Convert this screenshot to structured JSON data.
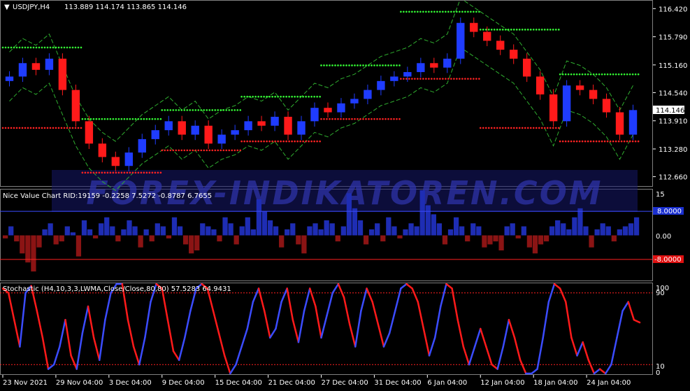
{
  "chart": {
    "symbol": "USDJPY,H4",
    "ohlc": "113.889 114.174 113.865 114.146",
    "current_price": "114.146",
    "watermark": "FOREX-INDIKATOREN.COM"
  },
  "colors": {
    "background": "#000000",
    "bull_candle": "#1f3cff",
    "bear_candle": "#ff1a1a",
    "envelope": "#2fae2f",
    "resistance_dots": "#35ff35",
    "support_dots": "#ff2222",
    "watermark": "#2b2f9c",
    "nvc_positive": "#1e2db4",
    "nvc_negative": "#8b1414",
    "stoch_up": "#3b4cff",
    "stoch_down": "#ff1a1a",
    "level_lines": "#ff2020"
  },
  "price_axis": [
    "116.420",
    "115.790",
    "115.160",
    "114.540",
    "113.910",
    "113.280",
    "112.660"
  ],
  "time_axis": [
    "23 Nov 2021",
    "29 Nov 04:00",
    "3 Dec 04:00",
    "9 Dec 04:00",
    "15 Dec 04:00",
    "21 Dec 04:00",
    "27 Dec 04:00",
    "31 Dec 04:00",
    "6 Jan 04:00",
    "12 Jan 04:00",
    "18 Jan 04:00",
    "24 Jan 04:00"
  ],
  "nvc": {
    "title": "Nice Value Chart RID:19159 -0.2258 7.5272 -0.8787 6.7655",
    "axis_top": "15",
    "axis_mid": "0.00",
    "level_upper": "8.0000",
    "level_lower": "-8.0000"
  },
  "stoch": {
    "title": "Stochastic (H4,10,3,3,LWMA,Close/Close,80,80) 57.5283 64.9431",
    "axis_100": "100",
    "axis_90": "90",
    "axis_10": "10",
    "axis_0": "0"
  },
  "chart_data": [
    {
      "type": "line",
      "title": "USDJPY,H4",
      "x": [
        0,
        4,
        8,
        12,
        16,
        20,
        24,
        28,
        32,
        36,
        40,
        44,
        48,
        52,
        56,
        60,
        64,
        68,
        72,
        76,
        80,
        84,
        88,
        92,
        96,
        100,
        104,
        108,
        112,
        116,
        120,
        124,
        128,
        132,
        136,
        140,
        144,
        148,
        152,
        156,
        160,
        164,
        168,
        172,
        176,
        180,
        184,
        188
      ],
      "x_tick_labels": [
        "23 Nov 2021",
        "29 Nov 04:00",
        "3 Dec 04:00",
        "9 Dec 04:00",
        "15 Dec 04:00",
        "21 Dec 04:00",
        "27 Dec 04:00",
        "31 Dec 04:00",
        "6 Jan 04:00",
        "12 Jan 04:00",
        "18 Jan 04:00",
        "24 Jan 04:00"
      ],
      "series": [
        {
          "name": "USDJPY",
          "values": [
            114.9,
            115.2,
            115.05,
            115.3,
            114.6,
            113.9,
            113.4,
            113.1,
            112.9,
            113.2,
            113.5,
            113.7,
            113.9,
            113.6,
            113.8,
            113.4,
            113.6,
            113.7,
            113.9,
            113.8,
            114.0,
            113.6,
            113.9,
            114.2,
            114.1,
            114.3,
            114.4,
            114.6,
            114.8,
            114.9,
            115.0,
            115.2,
            115.1,
            115.3,
            116.1,
            115.9,
            115.7,
            115.5,
            115.3,
            114.9,
            114.5,
            113.9,
            114.7,
            114.6,
            114.4,
            114.1,
            113.6,
            114.15
          ]
        }
      ],
      "ylim": [
        112.45,
        116.55
      ],
      "y_tick_labels": [
        "116.420",
        "115.790",
        "115.160",
        "114.540",
        "113.910",
        "113.280",
        "112.660"
      ]
    },
    {
      "type": "bar",
      "title": "Nice Value Chart RID:19159 -0.2258 7.5272 -0.8787 6.7655",
      "series": [
        {
          "name": "Nice Value Chart",
          "values": [
            -1,
            3,
            -2,
            -6,
            -9,
            -12,
            -4,
            2,
            4,
            -3,
            -2,
            3,
            1,
            -7,
            5,
            2,
            -1,
            4,
            6,
            3,
            -2,
            2,
            5,
            3,
            -4,
            2,
            -2,
            4,
            3,
            -1,
            6,
            3,
            -3,
            -6,
            -5,
            4,
            3,
            2,
            -2,
            6,
            4,
            -3,
            3,
            6,
            2,
            12,
            8,
            5,
            3,
            -4,
            2,
            4,
            -3,
            -6,
            3,
            4,
            2,
            5,
            4,
            -2,
            3,
            14,
            9,
            5,
            -3,
            2,
            4,
            -2,
            6,
            3,
            -1,
            2,
            4,
            3,
            15,
            10,
            7,
            4,
            -3,
            2,
            6,
            3,
            -2,
            4,
            3,
            -4,
            -3,
            -2,
            -5,
            3,
            4,
            -1,
            3,
            -4,
            -6,
            -3,
            -2,
            3,
            5,
            4,
            2,
            6,
            9,
            3,
            -4,
            2,
            4,
            3,
            -2,
            2,
            3,
            4,
            6
          ]
        }
      ],
      "ylim": [
        -15,
        15
      ],
      "levels": [
        8,
        -8
      ]
    },
    {
      "type": "line",
      "title": "Stochastic (H4,10,3,3,LWMA,Close/Close,80,80) 57.5283 64.9431",
      "series": [
        {
          "name": "Stochastic",
          "values": [
            95,
            90,
            60,
            30,
            90,
            98,
            70,
            40,
            5,
            10,
            30,
            60,
            20,
            5,
            45,
            75,
            40,
            15,
            60,
            90,
            100,
            100,
            60,
            30,
            10,
            40,
            80,
            100,
            95,
            60,
            25,
            15,
            40,
            70,
            95,
            100,
            95,
            70,
            45,
            20,
            0,
            10,
            30,
            50,
            80,
            95,
            70,
            40,
            50,
            80,
            95,
            60,
            35,
            70,
            95,
            75,
            40,
            65,
            90,
            100,
            85,
            55,
            30,
            70,
            95,
            80,
            55,
            30,
            45,
            70,
            95,
            100,
            95,
            80,
            50,
            20,
            40,
            75,
            100,
            95,
            60,
            30,
            10,
            30,
            50,
            30,
            10,
            5,
            30,
            60,
            40,
            15,
            0,
            0,
            5,
            40,
            80,
            100,
            95,
            80,
            40,
            20,
            35,
            15,
            0,
            5,
            0,
            10,
            40,
            70,
            80,
            60,
            57
          ]
        }
      ],
      "ylim": [
        0,
        100
      ],
      "levels": [
        90,
        10
      ]
    }
  ]
}
